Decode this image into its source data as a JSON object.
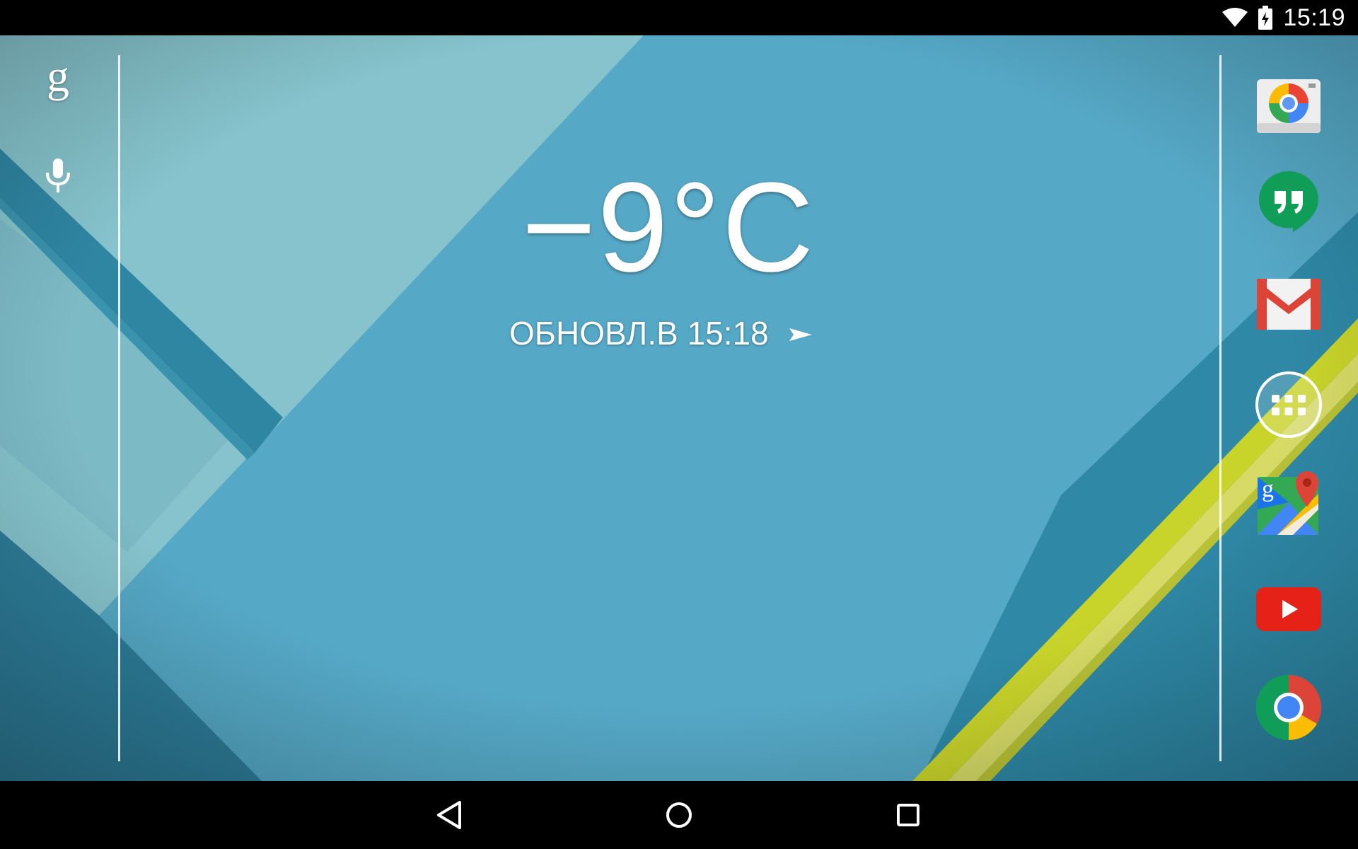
{
  "status_bar": {
    "time": "15:19",
    "icons": [
      "wifi-icon",
      "battery-charging-icon"
    ]
  },
  "left_bar": {
    "icons": [
      "google-search-icon",
      "microphone-icon"
    ],
    "google_letter": "g"
  },
  "weather_widget": {
    "temperature": "−9°C",
    "updated_label": "ОБНОВЛ.В 15:18",
    "icons": [
      "refresh-arrow-icon"
    ]
  },
  "dock": {
    "apps": [
      "camera-app-icon",
      "hangouts-app-icon",
      "gmail-app-icon",
      "app-drawer-icon",
      "maps-app-icon",
      "youtube-app-icon",
      "chrome-app-icon"
    ]
  },
  "nav_bar": {
    "buttons": [
      "back-icon",
      "home-icon",
      "recents-icon"
    ]
  },
  "colors": {
    "wallpaper_main": "#55a8c6",
    "wallpaper_light": "#86c3cc",
    "stripe_dark": "#2f86a3",
    "stripe_yellow": "#c9d42a"
  }
}
